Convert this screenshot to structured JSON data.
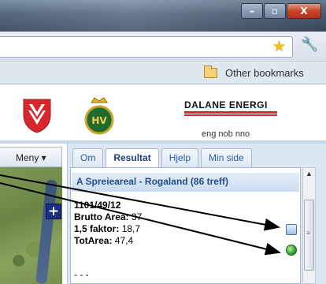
{
  "window": {
    "minimize_label": "–",
    "maximize_label": "▫",
    "close_label": "X"
  },
  "toolbar": {
    "bookmark_star": "★",
    "wrench": "🔧"
  },
  "bookmarks": {
    "other_bookmarks": "Other bookmarks"
  },
  "logos": {
    "hv_text": "HV",
    "dalane": "DALANE ENERGI",
    "languages": "eng nob nno"
  },
  "map": {
    "menu_label": "Meny ▾",
    "zoom_in": "+"
  },
  "tabs": [
    {
      "label": "Om"
    },
    {
      "label": "Resultat"
    },
    {
      "label": "Hjelp"
    },
    {
      "label": "Min side"
    }
  ],
  "result_panel": {
    "header": "A Spreieareal - Rogaland (86 treff)",
    "id": "1101/49/12",
    "rows": [
      {
        "label": "Brutto Area:",
        "value": " 37"
      },
      {
        "label": "1,5 faktor:",
        "value": " 18,7"
      },
      {
        "label": "TotArea:",
        "value": " 47,4"
      }
    ],
    "separator": "- - -"
  }
}
